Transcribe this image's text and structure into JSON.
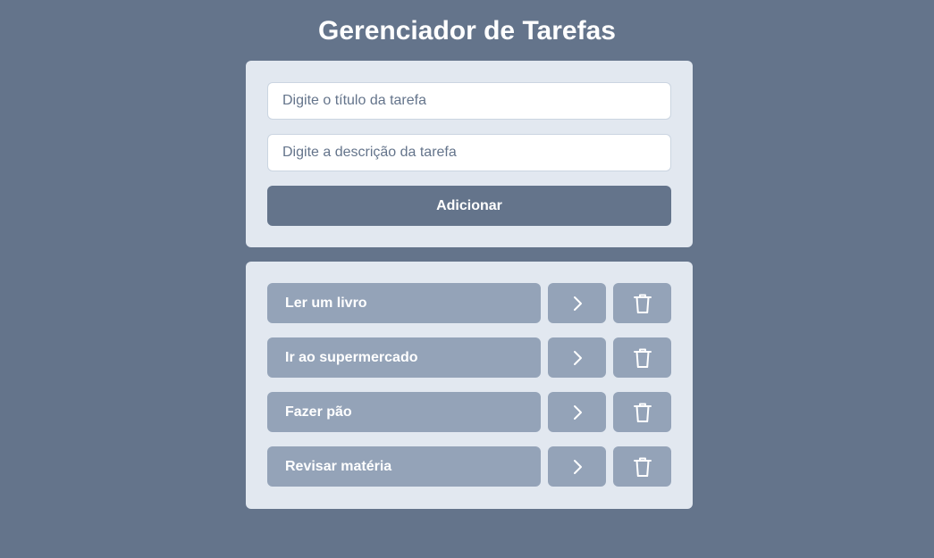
{
  "header": {
    "title": "Gerenciador de Tarefas"
  },
  "form": {
    "title_placeholder": "Digite o título da tarefa",
    "title_value": "",
    "description_placeholder": "Digite a descrição da tarefa",
    "description_value": "",
    "add_label": "Adicionar"
  },
  "tasks": [
    {
      "title": "Ler um livro",
      "details_icon": "chevron-right-icon",
      "delete_icon": "trash-icon"
    },
    {
      "title": "Ir ao supermercado",
      "details_icon": "chevron-right-icon",
      "delete_icon": "trash-icon"
    },
    {
      "title": "Fazer pão",
      "details_icon": "chevron-right-icon",
      "delete_icon": "trash-icon"
    },
    {
      "title": "Revisar matéria",
      "details_icon": "chevron-right-icon",
      "delete_icon": "trash-icon"
    }
  ],
  "colors": {
    "background": "#64748b",
    "card": "#e2e8f0",
    "task_button": "#94a3b8",
    "primary_button": "#64748b",
    "text_on_button": "#ffffff"
  }
}
